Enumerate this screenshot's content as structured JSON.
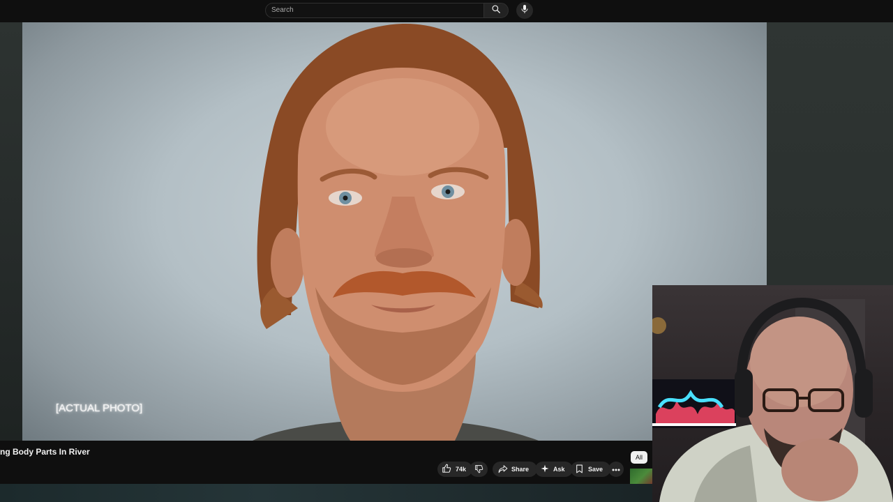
{
  "search": {
    "placeholder": "Search"
  },
  "video": {
    "caption": "[ACTUAL PHOTO]"
  },
  "info": {
    "title": "ng Body Parts In River"
  },
  "actions": {
    "likes": "74k",
    "share_label": "Share",
    "ask_label": "Ask",
    "save_label": "Save"
  },
  "chips": {
    "all_label": "All"
  },
  "colors": {
    "background": "#0f0f0f",
    "pill": "#272727",
    "text": "#f1f1f1"
  }
}
